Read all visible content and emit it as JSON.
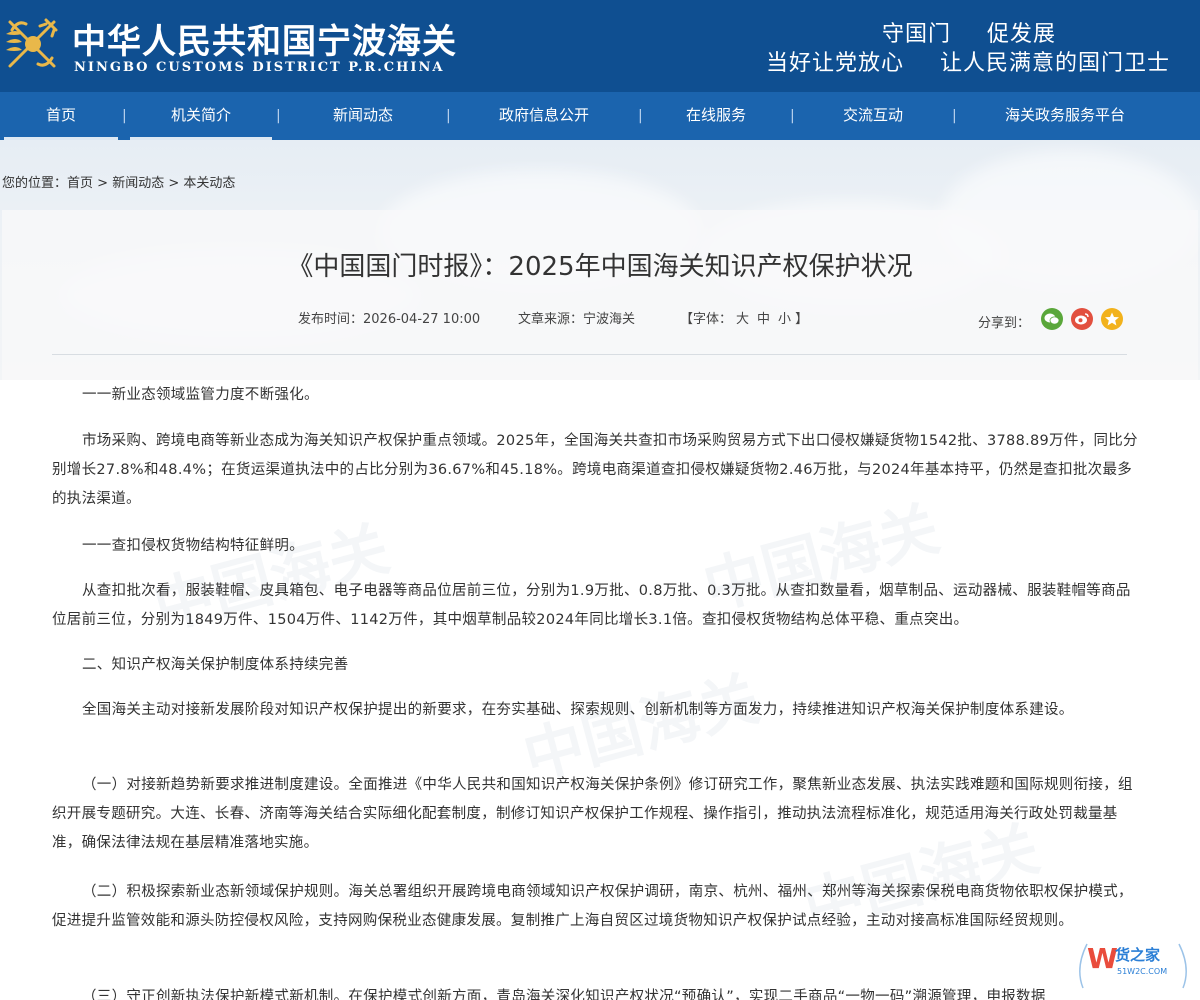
{
  "header": {
    "title_cn": "中华人民共和国宁波海关",
    "title_en": "NINGBO CUSTOMS DISTRICT P.R.CHINA",
    "slogan_line1_a": "守国门",
    "slogan_line1_b": "促发展",
    "slogan_line2_a": "当好让党放心",
    "slogan_line2_b": "让人民满意的国门卫士"
  },
  "nav": {
    "items": [
      {
        "label": "首页"
      },
      {
        "label": "机关简介"
      },
      {
        "label": "新闻动态"
      },
      {
        "label": "政府信息公开"
      },
      {
        "label": "在线服务"
      },
      {
        "label": "交流互动"
      },
      {
        "label": "海关政务服务平台"
      }
    ],
    "separator": "|"
  },
  "breadcrumb": {
    "prefix": "您的位置：",
    "items": [
      "首页",
      "新闻动态",
      "本关动态"
    ],
    "sep": " > "
  },
  "article": {
    "title": "《中国国门时报》：2025年中国海关知识产权保护状况",
    "publish_time": "发布时间：2026-04-27 10:00",
    "source": "文章来源：宁波海关",
    "font_label_open": "【字体：",
    "font_large": "大",
    "font_medium": "中",
    "font_small": "小",
    "font_label_close": "】",
    "share_label": "分享到：",
    "paragraphs": [
      "一一新业态领域监管力度不断强化。",
      "市场采购、跨境电商等新业态成为海关知识产权保护重点领域。2025年，全国海关共查扣市场采购贸易方式下出口侵权嫌疑货物1542批、3788.89万件，同比分别增长27.8%和48.4%；在货运渠道执法中的占比分别为36.67%和45.18%。跨境电商渠道查扣侵权嫌疑货物2.46万批，与2024年基本持平，仍然是查扣批次最多的执法渠道。",
      "一一查扣侵权货物结构特征鲜明。",
      "从查扣批次看，服装鞋帽、皮具箱包、电子电器等商品位居前三位，分别为1.9万批、0.8万批、0.3万批。从查扣数量看，烟草制品、运动器械、服装鞋帽等商品位居前三位，分别为1849万件、1504万件、1142万件，其中烟草制品较2024年同比增长3.1倍。查扣侵权货物结构总体平稳、重点突出。",
      "二、知识产权海关保护制度体系持续完善",
      "全国海关主动对接新发展阶段对知识产权保护提出的新要求，在夯实基础、探索规则、创新机制等方面发力，持续推进知识产权海关保护制度体系建设。",
      "（一）对接新趋势新要求推进制度建设。全面推进《中华人民共和国知识产权海关保护条例》修订研究工作，聚焦新业态发展、执法实践难题和国际规则衔接，组织开展专题研究。大连、长春、济南等海关结合实际细化配套制度，制修订知识产权保护工作规程、操作指引，推动执法流程标准化，规范适用海关行政处罚裁量基准，确保法律法规在基层精准落地实施。",
      "（二）积极探索新业态新领域保护规则。海关总署组织开展跨境电商领域知识产权保护调研，南京、杭州、福州、郑州等海关探索保税电商货物依职权保护模式，促进提升监管效能和源头防控侵权风险，支持网购保税业态健康发展。复制推广上海自贸区过境货物知识产权保护试点经验，主动对接高标准国际经贸规则。",
      "（三）守正创新执法保护新模式新机制。在保护模式创新方面，青岛海关深化知识产权状况“预确认”，实现二手商品“一物一码”溯源管理，申报数据"
    ]
  },
  "badge": {
    "name": "货之家",
    "url_text": "51W2C.COM"
  },
  "colors": {
    "header_blue": "#0f4f91",
    "nav_blue": "#1b64ae",
    "wechat_green": "#5aa73a",
    "weibo_red": "#e2503f",
    "qzone_yellow": "#f2b21c",
    "badge_blue": "#2b7fd6",
    "badge_red": "#e94c3c"
  }
}
